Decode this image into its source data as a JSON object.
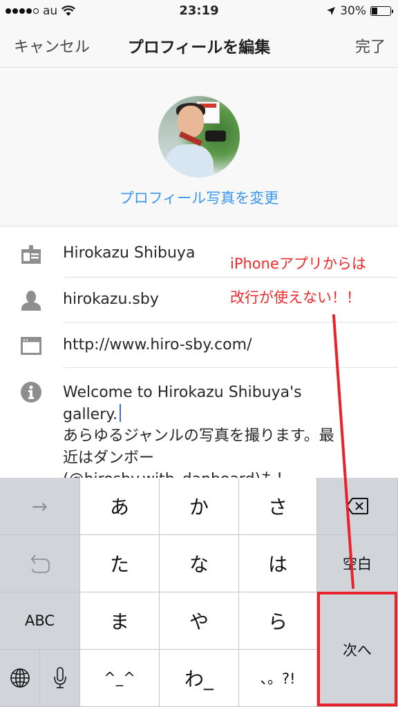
{
  "status_bar": {
    "carrier": "au",
    "signal_bars_filled": 4,
    "signal_bars_total": 5,
    "time": "23:19",
    "battery_percent": "30%",
    "battery_level": 0.3
  },
  "nav": {
    "cancel_label": "キャンセル",
    "title": "プロフィールを編集",
    "done_label": "完了"
  },
  "profile_photo": {
    "change_label": "プロフィール写真を変更"
  },
  "fields": {
    "name": {
      "icon": "id-card-icon",
      "value": "Hirokazu Shibuya"
    },
    "username": {
      "icon": "person-icon",
      "value": "hirokazu.sby"
    },
    "website": {
      "icon": "browser-window-icon",
      "value": "http://www.hiro-sby.com/"
    },
    "bio": {
      "icon": "info-icon",
      "line1": "Welcome to Hirokazu Shibuya's",
      "line2": "gallery.",
      "line3": "あらゆるジャンルの写真を撮ります。最",
      "line4": "近はダンボー",
      "line5": "(@hirosby.with_danboard)も！"
    }
  },
  "annotation": {
    "line1": "iPhoneアプリからは",
    "line2": "改行が使えない！！",
    "color": "#ee2a2a"
  },
  "keyboard": {
    "keys": {
      "next_char": "→",
      "undo": "↺",
      "abc": "ABC",
      "globe": "globe-icon",
      "mic": "mic-icon",
      "a": "あ",
      "ka": "か",
      "sa": "さ",
      "ta": "た",
      "na": "な",
      "ha": "は",
      "ma": "ま",
      "ya": "や",
      "ra": "ら",
      "kaomoji": "^_^",
      "wa": "わ_",
      "punct": "、。?!",
      "delete": "delete-icon",
      "space": "空白",
      "next": "次へ"
    }
  }
}
